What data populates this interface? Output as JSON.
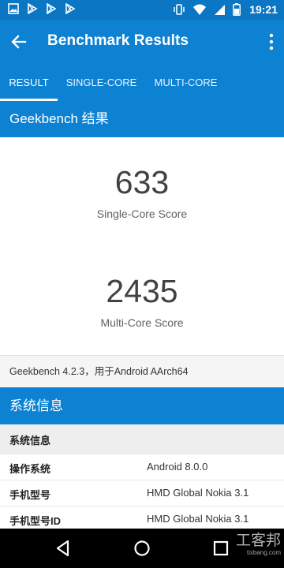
{
  "status_bar": {
    "time": "19:21",
    "left_icons": [
      "image-icon",
      "play-store-icon",
      "play-store-icon",
      "play-store-icon"
    ],
    "right_icons": [
      "vibrate-icon",
      "wifi-icon",
      "cellular-icon",
      "battery-icon"
    ]
  },
  "app_bar": {
    "title": "Benchmark Results",
    "back_icon": "arrow-back-icon",
    "overflow_icon": "more-vert-icon"
  },
  "tabs": [
    {
      "label": "RESULT",
      "active": true
    },
    {
      "label": "SINGLE-CORE",
      "active": false
    },
    {
      "label": "MULTI-CORE",
      "active": false
    }
  ],
  "geekbench_section": {
    "title": "Geekbench 结果"
  },
  "scores": {
    "single": {
      "value": "633",
      "label": "Single-Core Score"
    },
    "multi": {
      "value": "2435",
      "label": "Multi-Core Score"
    }
  },
  "version_text": "Geekbench 4.2.3，用于Android AArch64",
  "system_section": {
    "title": "系统信息"
  },
  "system_info": {
    "header": "系统信息",
    "rows": [
      {
        "key": "操作系统",
        "value": "Android 8.0.0"
      },
      {
        "key": "手机型号",
        "value": "HMD Global Nokia 3.1"
      },
      {
        "key": "手机型号ID",
        "value": "HMD Global Nokia 3.1"
      }
    ]
  },
  "nav_bar": {
    "icons": [
      "back-triangle-icon",
      "home-circle-icon",
      "recents-square-icon"
    ]
  },
  "watermark": {
    "text": "工客邦",
    "sub": "tixbang.com"
  },
  "colors": {
    "primary": "#0d82d3",
    "status": "#0a76c4"
  }
}
